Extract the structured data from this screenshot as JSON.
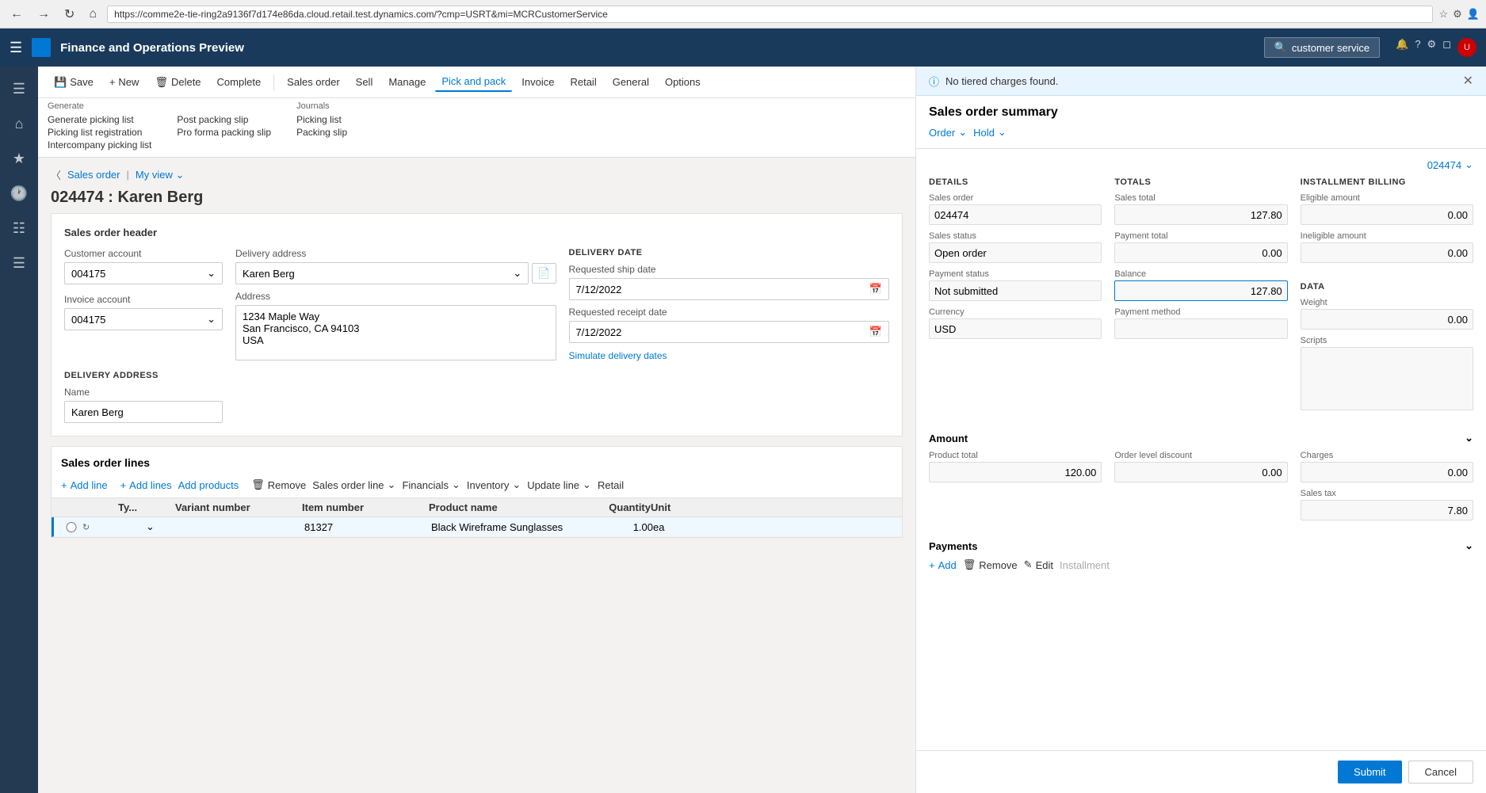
{
  "browser": {
    "url": "https://comme2e-tie-ring2a9136f7d174e86da.cloud.retail.test.dynamics.com/?cmp=USRT&mi=MCRCustomerService",
    "back_title": "Back",
    "forward_title": "Forward",
    "refresh_title": "Refresh"
  },
  "app": {
    "title": "Finance and Operations Preview",
    "search_placeholder": "customer service"
  },
  "sidebar": {
    "icons": [
      "≡",
      "⌂",
      "★",
      "⏱",
      "📋",
      "☰"
    ]
  },
  "toolbar": {
    "save_label": "Save",
    "new_label": "New",
    "delete_label": "Delete",
    "complete_label": "Complete",
    "sales_order_label": "Sales order",
    "sell_label": "Sell",
    "manage_label": "Manage",
    "pick_and_pack_label": "Pick and pack",
    "invoice_label": "Invoice",
    "retail_label": "Retail",
    "general_label": "General",
    "options_label": "Options"
  },
  "generate_group": {
    "label": "Generate",
    "items": [
      {
        "label": "Generate picking list",
        "disabled": false
      },
      {
        "label": "Picking list registration",
        "disabled": false
      },
      {
        "label": "Intercompany picking list",
        "disabled": false
      }
    ]
  },
  "journals_group": {
    "label": "Journals",
    "items": [
      {
        "label": "Post packing slip",
        "disabled": false
      },
      {
        "label": "Pro forma packing slip",
        "disabled": false
      }
    ]
  },
  "journals_list": {
    "items": [
      {
        "label": "Picking list"
      },
      {
        "label": "Packing slip"
      }
    ]
  },
  "filter": {
    "view_label": "Sales order",
    "my_view_label": "My view"
  },
  "order": {
    "id": "024474",
    "customer_name": "Karen Berg",
    "title": "024474 : Karen Berg"
  },
  "header_section": {
    "title": "Sales order header",
    "customer_account_label": "Customer account",
    "customer_account_value": "004175",
    "invoice_account_label": "Invoice account",
    "invoice_account_value": "004175",
    "delivery_address_label": "Delivery address",
    "delivery_address_value": "Karen Berg",
    "address_label": "Address",
    "address_line1": "1234 Maple Way",
    "address_line2": "San Francisco, CA 94103",
    "address_line3": "USA",
    "delivery_date_label": "DELIVERY DATE",
    "requested_ship_label": "Requested ship date",
    "requested_ship_value": "7/12/2022",
    "requested_receipt_label": "Requested receipt date",
    "requested_receipt_value": "7/12/2022",
    "simulate_label": "Simulate delivery dates"
  },
  "delivery_address_section": {
    "title": "DELIVERY ADDRESS",
    "name_label": "Name",
    "name_value": "Karen Berg"
  },
  "lines_section": {
    "title": "Sales order lines",
    "add_line_label": "Add line",
    "add_lines_label": "Add lines",
    "add_products_label": "Add products",
    "remove_label": "Remove",
    "sales_order_line_label": "Sales order line",
    "financials_label": "Financials",
    "inventory_label": "Inventory",
    "update_line_label": "Update line",
    "retail_label": "Retail",
    "columns": {
      "select": "",
      "refresh": "",
      "alert": "",
      "type": "Ty...",
      "variant": "Variant number",
      "item_number": "Item number",
      "product_name": "Product name",
      "quantity": "Quantity",
      "unit": "Unit"
    },
    "rows": [
      {
        "item_number": "81327",
        "product_name": "Black Wireframe Sunglasses",
        "quantity": "1.00",
        "unit": "ea"
      }
    ]
  },
  "panel": {
    "notification": "No tiered charges found.",
    "title": "Sales order summary",
    "order_label": "Order",
    "hold_label": "Hold",
    "order_num": "024474",
    "details_title": "DETAILS",
    "totals_title": "TOTALS",
    "installment_title": "INSTALLMENT BILLING",
    "sales_order_label": "Sales order",
    "sales_order_value": "024474",
    "sales_status_label": "Sales status",
    "sales_status_value": "Open order",
    "payment_status_label": "Payment status",
    "payment_status_value": "Not submitted",
    "currency_label": "Currency",
    "currency_value": "USD",
    "sales_total_label": "Sales total",
    "sales_total_value": "127.80",
    "payment_total_label": "Payment total",
    "payment_total_value": "0.00",
    "balance_label": "Balance",
    "balance_value": "127.80",
    "payment_method_label": "Payment method",
    "payment_method_value": "",
    "eligible_amount_label": "Eligible amount",
    "eligible_amount_value": "0.00",
    "ineligible_amount_label": "Ineligible amount",
    "ineligible_amount_value": "0.00",
    "data_title": "DATA",
    "weight_label": "Weight",
    "weight_value": "0.00",
    "scripts_label": "Scripts",
    "scripts_value": "",
    "amount_title": "Amount",
    "product_total_label": "Product total",
    "product_total_value": "120.00",
    "order_level_discount_label": "Order level discount",
    "order_level_discount_value": "0.00",
    "charges_label": "Charges",
    "charges_value": "0.00",
    "sales_tax_label": "Sales tax",
    "sales_tax_value": "7.80",
    "payments_title": "Payments",
    "add_payment_label": "Add",
    "remove_payment_label": "Remove",
    "edit_payment_label": "Edit",
    "installment_label": "Installment",
    "submit_label": "Submit",
    "cancel_label": "Cancel"
  }
}
